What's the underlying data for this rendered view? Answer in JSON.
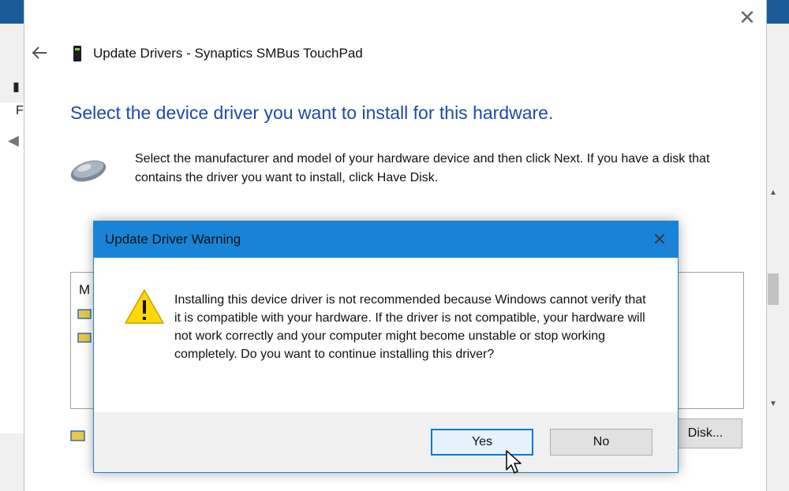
{
  "window": {
    "title": "Update Drivers - Synaptics SMBus TouchPad",
    "heading": "Select the device driver you want to install for this hardware.",
    "instructions": "Select the manufacturer and model of your hardware device and then click Next. If you have a disk that contains the driver you want to install, click Have Disk.",
    "list_header": "M",
    "have_disk_label": "Disk...",
    "icons": {
      "back": "back-arrow-icon",
      "close": "close-icon",
      "device": "touchpad-chip-icon",
      "mouse": "mouse-icon"
    }
  },
  "background_window": {
    "glyphs": [
      "F"
    ]
  },
  "dialog": {
    "title": "Update Driver Warning",
    "message": "Installing this device driver is not recommended because Windows cannot verify that it is compatible with your hardware.  If the driver is not compatible, your hardware will not work correctly and your computer might become unstable or stop working completely.  Do you want to continue installing this driver?",
    "yes_label": "Yes",
    "no_label": "No",
    "icon": "warning-icon"
  },
  "colors": {
    "accent": "#1883d7",
    "heading": "#1e4aa8",
    "warning": "#ffd800",
    "desktop": "#1a5a97"
  }
}
